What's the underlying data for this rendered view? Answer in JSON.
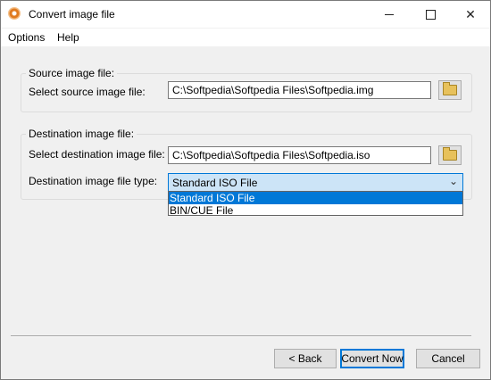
{
  "window": {
    "title": "Convert image file",
    "app_icon": "disc-icon",
    "controls": {
      "minimize": "minimize-icon",
      "maximize": "maximize-icon",
      "close": "close-icon"
    }
  },
  "menu": {
    "items": [
      "Options",
      "Help"
    ]
  },
  "source": {
    "group_title": "Source image file:",
    "label": "Select source image file:",
    "value": "C:\\Softpedia\\Softpedia Files\\Softpedia.img",
    "browse_icon": "folder-icon"
  },
  "destination": {
    "group_title": "Destination image file:",
    "label": "Select destination image file:",
    "value": "C:\\Softpedia\\Softpedia Files\\Softpedia.iso",
    "browse_icon": "folder-icon",
    "type_label": "Destination image file type:",
    "type_selected": "Standard ISO File",
    "type_options": [
      "Standard ISO File",
      "BIN/CUE File"
    ]
  },
  "buttons": {
    "back": "< Back",
    "convert": "Convert Now",
    "cancel": "Cancel"
  },
  "colors": {
    "accent": "#0078d7",
    "selection_bg": "#cce4f7"
  }
}
